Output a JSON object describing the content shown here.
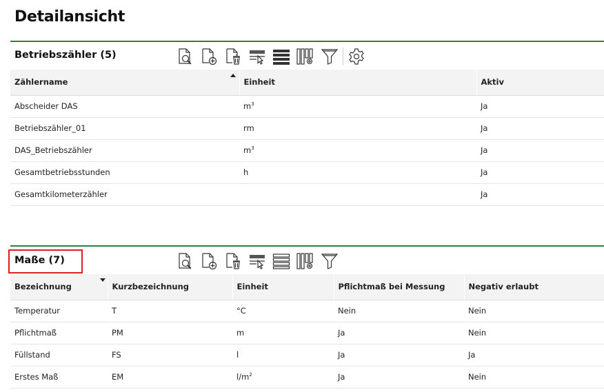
{
  "page": {
    "title": "Detailansicht"
  },
  "accent_color": "#2e7d44",
  "highlight_color": "#e21b1b",
  "sections": [
    {
      "title": "Betriebszähler (5)",
      "toolbar_icons": [
        "search-document-icon",
        "add-document-icon",
        "delete-document-icon",
        "select-row-icon",
        "rows-icon",
        "column-settings-icon",
        "filter-icon",
        "settings-icon"
      ],
      "columns": [
        "Zählername",
        "Einheit",
        "Aktiv"
      ],
      "sort_column": 0,
      "sort_dir": "asc",
      "rows": [
        [
          "Abscheider DAS",
          "m³",
          "Ja"
        ],
        [
          "Betriebszähler_01",
          "rm",
          "Ja"
        ],
        [
          "DAS_Betriebszähler",
          "m³",
          "Ja"
        ],
        [
          "Gesamtbetriebsstunden",
          "h",
          "Ja"
        ],
        [
          "Gesamtkilometerzähler",
          "",
          "Ja"
        ]
      ]
    },
    {
      "title": "Maße (7)",
      "highlighted": true,
      "toolbar_icons": [
        "search-document-icon",
        "add-document-icon",
        "delete-document-icon",
        "select-row-icon",
        "rows-icon",
        "column-settings-icon",
        "filter-icon"
      ],
      "columns": [
        "Bezeichnung",
        "Kurzbezeichnung",
        "Einheit",
        "Pflichtmaß bei Messung",
        "Negativ erlaubt"
      ],
      "sort_column": 0,
      "sort_dir": "desc",
      "rows": [
        [
          "Temperatur",
          "T",
          "°C",
          "Nein",
          "Nein"
        ],
        [
          "Pflichtmaß",
          "PM",
          "m",
          "Ja",
          "Nein"
        ],
        [
          "Füllstand",
          "FS",
          "l",
          "Ja",
          "Ja"
        ],
        [
          "Erstes Maß",
          "EM",
          "l/m²",
          "Ja",
          "Nein"
        ]
      ]
    }
  ]
}
